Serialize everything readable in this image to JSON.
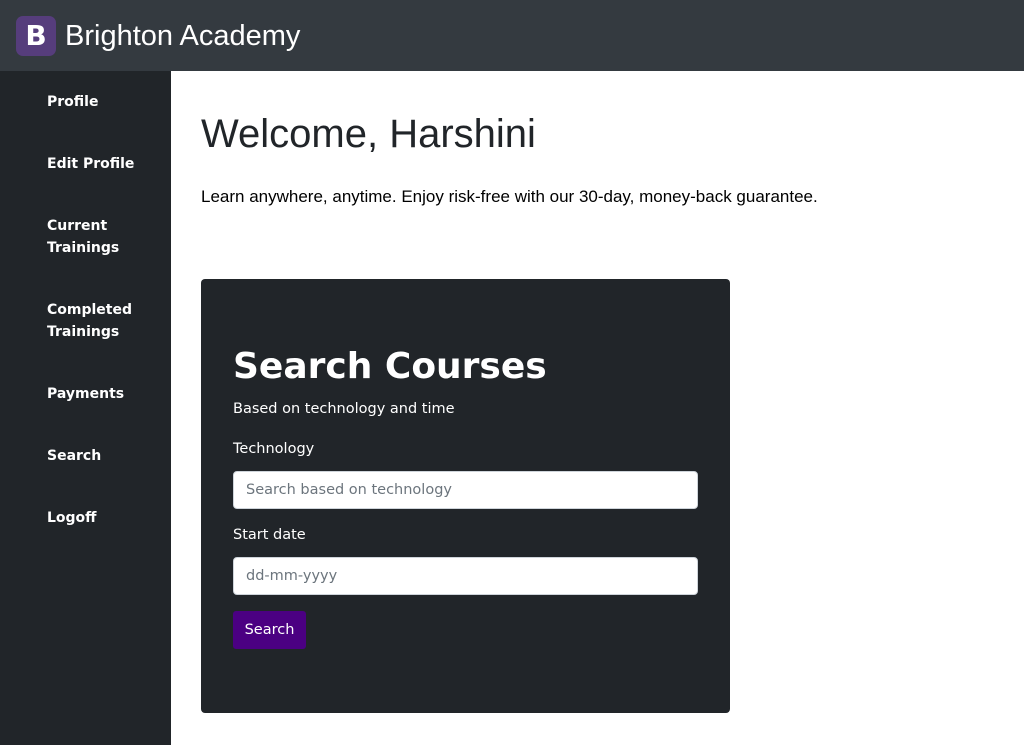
{
  "header": {
    "logo_letter": "B",
    "brand": "Brighton Academy"
  },
  "sidebar": {
    "items": [
      {
        "label": "Profile"
      },
      {
        "label": "Edit Profile"
      },
      {
        "label": "Current Trainings"
      },
      {
        "label": "Completed Trainings"
      },
      {
        "label": "Payments"
      },
      {
        "label": "Search"
      },
      {
        "label": "Logoff"
      }
    ]
  },
  "main": {
    "welcome": "Welcome, Harshini",
    "tagline": "Learn anywhere, anytime. Enjoy risk-free with our 30-day, money-back guarantee."
  },
  "search_card": {
    "title": "Search Courses",
    "subtitle": "Based on technology and time",
    "technology_label": "Technology",
    "technology_placeholder": "Search based on technology",
    "start_date_label": "Start date",
    "start_date_placeholder": "dd-mm-yyyy",
    "button_label": "Search"
  },
  "colors": {
    "topbar": "#343a40",
    "sidebar": "#212529",
    "brand_logo": "#563d7c",
    "button": "#4b0082"
  }
}
